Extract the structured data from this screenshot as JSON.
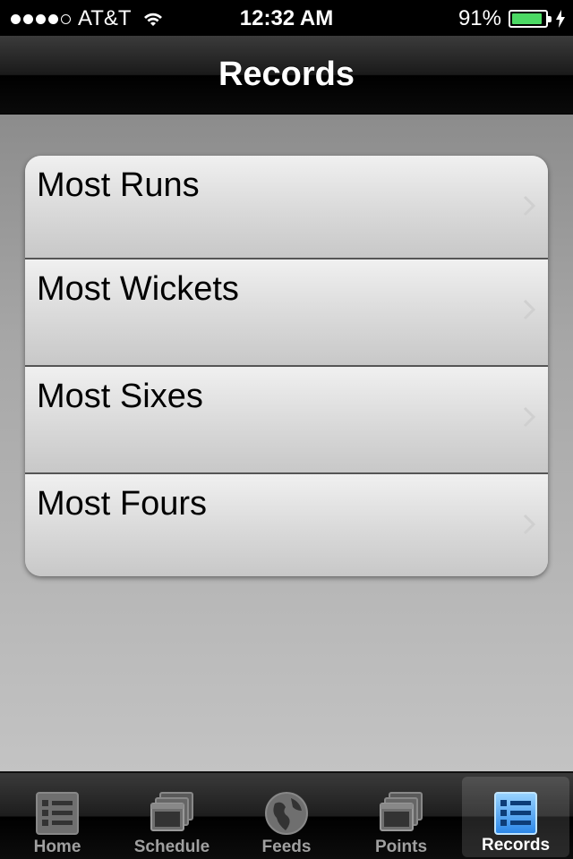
{
  "status_bar": {
    "carrier": "AT&T",
    "time": "12:32 AM",
    "battery_percent": "91%",
    "battery_level": 0.91,
    "signal_bars_filled": 4,
    "signal_bars_total": 5,
    "battery_color": "#4cd964"
  },
  "nav_bar": {
    "title": "Records"
  },
  "records_list": {
    "items": [
      {
        "label": "Most Runs",
        "icon": "chevron-right-icon"
      },
      {
        "label": "Most Wickets",
        "icon": "chevron-right-icon"
      },
      {
        "label": "Most Sixes",
        "icon": "chevron-right-icon"
      },
      {
        "label": "Most Fours",
        "icon": "chevron-right-icon"
      }
    ]
  },
  "tab_bar": {
    "tabs": [
      {
        "label": "Home",
        "icon": "list-icon",
        "selected": false
      },
      {
        "label": "Schedule",
        "icon": "windows-icon",
        "selected": false
      },
      {
        "label": "Feeds",
        "icon": "globe-icon",
        "selected": false
      },
      {
        "label": "Points",
        "icon": "windows-icon",
        "selected": false
      },
      {
        "label": "Records",
        "icon": "list-icon",
        "selected": true
      }
    ],
    "selected_color": "#4aa3ff"
  }
}
